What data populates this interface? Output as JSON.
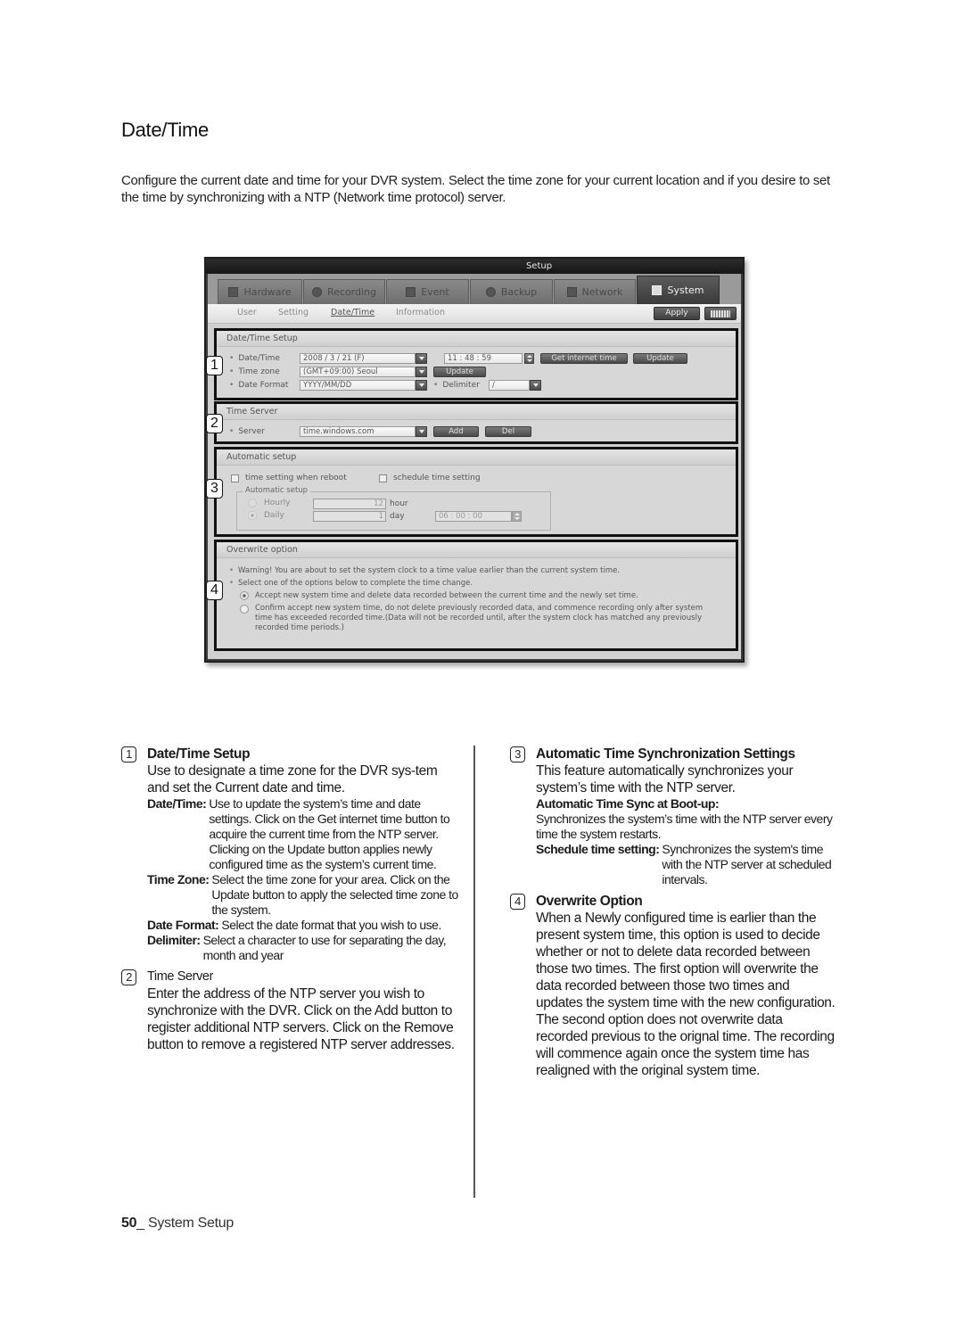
{
  "page": {
    "title": "Date/Time",
    "intro": "Configure the current date and time for your DVR system. Select the time zone for your current location and if you desire to set the time by synchronizing with a NTP (Network time protocol) server."
  },
  "dvr": {
    "window_title": "Setup",
    "tabs": [
      {
        "label": "Hardware",
        "icon": "hardware-icon",
        "active": false
      },
      {
        "label": "Recording",
        "icon": "recording-icon",
        "active": false
      },
      {
        "label": "Event",
        "icon": "event-icon",
        "active": false
      },
      {
        "label": "Backup",
        "icon": "backup-icon",
        "active": false
      },
      {
        "label": "Network",
        "icon": "network-icon",
        "active": false
      },
      {
        "label": "System",
        "icon": "system-icon",
        "active": true
      }
    ],
    "subtabs": [
      {
        "label": "User",
        "active": false
      },
      {
        "label": "Setting",
        "active": false
      },
      {
        "label": "Date/Time",
        "active": true
      },
      {
        "label": "Information",
        "active": false
      }
    ],
    "apply_label": "Apply",
    "keyboard_icon": "keyboard-icon",
    "datetime_setup": {
      "header": "Date/Time Setup",
      "date_time_label": "Date/Time",
      "date_value": "2008   /   3   /  21    (F)",
      "time_value": "11   :   48   :   59",
      "get_internet_time_label": "Get internet time",
      "update_label": "Update",
      "time_zone_label": "Time zone",
      "time_zone_value": "(GMT+09:00) Seoul",
      "tz_update_label": "Update",
      "date_format_label": "Date Format",
      "date_format_value": "YYYY/MM/DD",
      "delimiter_label": "Delimiter",
      "delimiter_value": "/"
    },
    "time_server": {
      "header": "Time Server",
      "server_label": "Server",
      "server_value": "time.windows.com",
      "add_label": "Add",
      "del_label": "Del"
    },
    "automatic_setup": {
      "header": "Automatic setup",
      "reboot_checkbox_label": "time setting when reboot",
      "reboot_checked": false,
      "schedule_checkbox_label": "schedule time setting",
      "schedule_checked": false,
      "group_label": "Automatic setup",
      "hourly_label": "Hourly",
      "hourly_value": "12",
      "hour_unit": "hour",
      "daily_label": "Daily",
      "daily_value": "1",
      "day_unit": "day",
      "daily_time_value": "06   :   00   :   00",
      "selected_mode": "Daily"
    },
    "overwrite": {
      "header": "Overwrite option",
      "warning": "Warning! You are about to set the system clock to a time value earlier than the current system time.",
      "instruction": "Select one of the options below to complete the time change.",
      "option1": "Accept new system time and delete data recorded between the current time and the newly set time.",
      "option2_line1": "Confirm accept new system time, do not delete previously recorded data, and commence recording only after system",
      "option2_line2": "time has exceeded recorded time.(Data will not be recorded until, after the system clock has matched any previously",
      "option2_line3": "recorded time periods.)",
      "selected_option": 1
    },
    "callouts": [
      "1",
      "2",
      "3",
      "4"
    ]
  },
  "sections": {
    "s1": {
      "num": "1",
      "title": "Date/Time Setup",
      "body": "Use to designate a time zone for the DVR sys-tem and set the Current date and time.",
      "defs": [
        {
          "term": "Date/Time:",
          "text": "Use to update the system’s time and date settings. Click on the Get internet time button to acquire the current time from the NTP server. Clicking on the Update button applies newly configured time as the system’s current time."
        },
        {
          "term": "Time Zone:",
          "text": "Select the time zone for your area. Click on the Update button to apply the selected time zone to the system."
        },
        {
          "term": "Date Format:",
          "text": "Select the date format that you wish to use."
        },
        {
          "term": "Delimiter:",
          "text": "Select a character to use for separating the day, month and year"
        }
      ]
    },
    "s2": {
      "num": "2",
      "title": "Time Server",
      "body": "Enter the address of the NTP server you wish to synchronize with the DVR. Click on the Add button to register additional NTP servers. Click on the Remove button to remove a registered NTP server addresses."
    },
    "s3": {
      "num": "3",
      "title": "Automatic Time Synchronization Settings",
      "body": "This feature automatically synchronizes your system’s time with the NTP server.",
      "boot_term": "Automatic Time Sync at Boot-up:",
      "boot_text": "Synchronizes the system’s time with the NTP server every time the system restarts.",
      "schedule_term": "Schedule time setting:",
      "schedule_text": "Synchronizes the system's time with the NTP server at scheduled intervals."
    },
    "s4": {
      "num": "4",
      "title": "Overwrite Option",
      "body": "When a Newly configured time is earlier than the present system time, this option is used to decide whether or not to delete data recorded between those two times. The first option will overwrite the data recorded between those two times and updates the system time with the new configuration. The second option does not overwrite data recorded previous to the orignal time. The recording will commence again once the system time has realigned with the original system time."
    }
  },
  "footer": {
    "page_number": "50",
    "section": "_ System Setup"
  }
}
